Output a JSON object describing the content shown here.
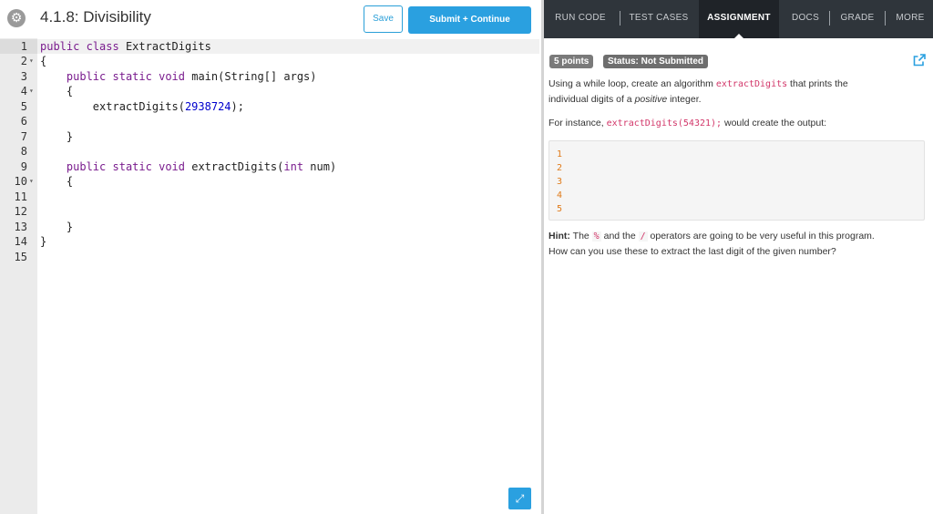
{
  "header": {
    "title": "4.1.8: Divisibility",
    "save_label": "Save",
    "submit_label": "Submit + Continue",
    "settings_icon": "gear-icon",
    "expand_icon": "expand-icon"
  },
  "editor": {
    "lines": [
      {
        "n": "1",
        "fold": "",
        "code": "public class ExtractDigits"
      },
      {
        "n": "2",
        "fold": "▾",
        "code": "{"
      },
      {
        "n": "3",
        "fold": "",
        "code": "    public static void main(String[] args)"
      },
      {
        "n": "4",
        "fold": "▾",
        "code": "    {"
      },
      {
        "n": "5",
        "fold": "",
        "code": "        extractDigits(2938724);"
      },
      {
        "n": "6",
        "fold": "",
        "code": ""
      },
      {
        "n": "7",
        "fold": "",
        "code": "    }"
      },
      {
        "n": "8",
        "fold": "",
        "code": ""
      },
      {
        "n": "9",
        "fold": "",
        "code": "    public static void extractDigits(int num)"
      },
      {
        "n": "10",
        "fold": "▾",
        "code": "    {"
      },
      {
        "n": "11",
        "fold": "",
        "code": ""
      },
      {
        "n": "12",
        "fold": "",
        "code": ""
      },
      {
        "n": "13",
        "fold": "",
        "code": "    }"
      },
      {
        "n": "14",
        "fold": "",
        "code": "}"
      },
      {
        "n": "15",
        "fold": "",
        "code": ""
      }
    ]
  },
  "tabs": [
    {
      "label": "RUN CODE"
    },
    {
      "label": "TEST CASES"
    },
    {
      "label": "ASSIGNMENT"
    },
    {
      "label": "DOCS"
    },
    {
      "label": "GRADE"
    },
    {
      "label": "MORE"
    }
  ],
  "assignment": {
    "points_badge": "5 points",
    "status_badge": "Status: Not Submitted",
    "intro_1": "Using a while loop, create an algorithm ",
    "intro_code": "extractDigits",
    "intro_2": " that prints the",
    "intro_3": "individual digits of a ",
    "intro_em": "positive",
    "intro_4": " integer.",
    "instance_1": "For instance, ",
    "instance_code": "extractDigits(54321);",
    "instance_2": " would create the output:",
    "output": [
      "1",
      "2",
      "3",
      "4",
      "5"
    ],
    "hint_label": "Hint:",
    "hint_1": " The ",
    "hint_op1": "%",
    "hint_2": " and the ",
    "hint_op2": "/",
    "hint_3": " operators are going to be very useful in this program.",
    "hint_4": "How can you use these to extract the last digit of the given number?",
    "external_link_icon": "external-link-icon"
  }
}
